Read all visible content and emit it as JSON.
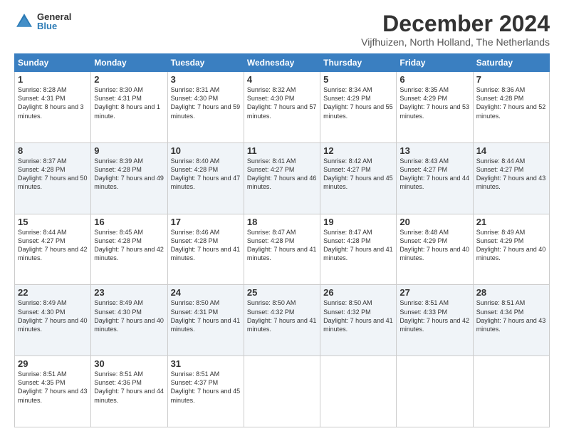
{
  "logo": {
    "general": "General",
    "blue": "Blue"
  },
  "title": "December 2024",
  "location": "Vijfhuizen, North Holland, The Netherlands",
  "days_header": [
    "Sunday",
    "Monday",
    "Tuesday",
    "Wednesday",
    "Thursday",
    "Friday",
    "Saturday"
  ],
  "weeks": [
    [
      {
        "day": "1",
        "sunrise": "8:28 AM",
        "sunset": "4:31 PM",
        "daylight": "8 hours and 3 minutes."
      },
      {
        "day": "2",
        "sunrise": "8:30 AM",
        "sunset": "4:31 PM",
        "daylight": "8 hours and 1 minute."
      },
      {
        "day": "3",
        "sunrise": "8:31 AM",
        "sunset": "4:30 PM",
        "daylight": "7 hours and 59 minutes."
      },
      {
        "day": "4",
        "sunrise": "8:32 AM",
        "sunset": "4:30 PM",
        "daylight": "7 hours and 57 minutes."
      },
      {
        "day": "5",
        "sunrise": "8:34 AM",
        "sunset": "4:29 PM",
        "daylight": "7 hours and 55 minutes."
      },
      {
        "day": "6",
        "sunrise": "8:35 AM",
        "sunset": "4:29 PM",
        "daylight": "7 hours and 53 minutes."
      },
      {
        "day": "7",
        "sunrise": "8:36 AM",
        "sunset": "4:28 PM",
        "daylight": "7 hours and 52 minutes."
      }
    ],
    [
      {
        "day": "8",
        "sunrise": "8:37 AM",
        "sunset": "4:28 PM",
        "daylight": "7 hours and 50 minutes."
      },
      {
        "day": "9",
        "sunrise": "8:39 AM",
        "sunset": "4:28 PM",
        "daylight": "7 hours and 49 minutes."
      },
      {
        "day": "10",
        "sunrise": "8:40 AM",
        "sunset": "4:28 PM",
        "daylight": "7 hours and 47 minutes."
      },
      {
        "day": "11",
        "sunrise": "8:41 AM",
        "sunset": "4:27 PM",
        "daylight": "7 hours and 46 minutes."
      },
      {
        "day": "12",
        "sunrise": "8:42 AM",
        "sunset": "4:27 PM",
        "daylight": "7 hours and 45 minutes."
      },
      {
        "day": "13",
        "sunrise": "8:43 AM",
        "sunset": "4:27 PM",
        "daylight": "7 hours and 44 minutes."
      },
      {
        "day": "14",
        "sunrise": "8:44 AM",
        "sunset": "4:27 PM",
        "daylight": "7 hours and 43 minutes."
      }
    ],
    [
      {
        "day": "15",
        "sunrise": "8:44 AM",
        "sunset": "4:27 PM",
        "daylight": "7 hours and 42 minutes."
      },
      {
        "day": "16",
        "sunrise": "8:45 AM",
        "sunset": "4:28 PM",
        "daylight": "7 hours and 42 minutes."
      },
      {
        "day": "17",
        "sunrise": "8:46 AM",
        "sunset": "4:28 PM",
        "daylight": "7 hours and 41 minutes."
      },
      {
        "day": "18",
        "sunrise": "8:47 AM",
        "sunset": "4:28 PM",
        "daylight": "7 hours and 41 minutes."
      },
      {
        "day": "19",
        "sunrise": "8:47 AM",
        "sunset": "4:28 PM",
        "daylight": "7 hours and 41 minutes."
      },
      {
        "day": "20",
        "sunrise": "8:48 AM",
        "sunset": "4:29 PM",
        "daylight": "7 hours and 40 minutes."
      },
      {
        "day": "21",
        "sunrise": "8:49 AM",
        "sunset": "4:29 PM",
        "daylight": "7 hours and 40 minutes."
      }
    ],
    [
      {
        "day": "22",
        "sunrise": "8:49 AM",
        "sunset": "4:30 PM",
        "daylight": "7 hours and 40 minutes."
      },
      {
        "day": "23",
        "sunrise": "8:49 AM",
        "sunset": "4:30 PM",
        "daylight": "7 hours and 40 minutes."
      },
      {
        "day": "24",
        "sunrise": "8:50 AM",
        "sunset": "4:31 PM",
        "daylight": "7 hours and 41 minutes."
      },
      {
        "day": "25",
        "sunrise": "8:50 AM",
        "sunset": "4:32 PM",
        "daylight": "7 hours and 41 minutes."
      },
      {
        "day": "26",
        "sunrise": "8:50 AM",
        "sunset": "4:32 PM",
        "daylight": "7 hours and 41 minutes."
      },
      {
        "day": "27",
        "sunrise": "8:51 AM",
        "sunset": "4:33 PM",
        "daylight": "7 hours and 42 minutes."
      },
      {
        "day": "28",
        "sunrise": "8:51 AM",
        "sunset": "4:34 PM",
        "daylight": "7 hours and 43 minutes."
      }
    ],
    [
      {
        "day": "29",
        "sunrise": "8:51 AM",
        "sunset": "4:35 PM",
        "daylight": "7 hours and 43 minutes."
      },
      {
        "day": "30",
        "sunrise": "8:51 AM",
        "sunset": "4:36 PM",
        "daylight": "7 hours and 44 minutes."
      },
      {
        "day": "31",
        "sunrise": "8:51 AM",
        "sunset": "4:37 PM",
        "daylight": "7 hours and 45 minutes."
      },
      null,
      null,
      null,
      null
    ]
  ]
}
